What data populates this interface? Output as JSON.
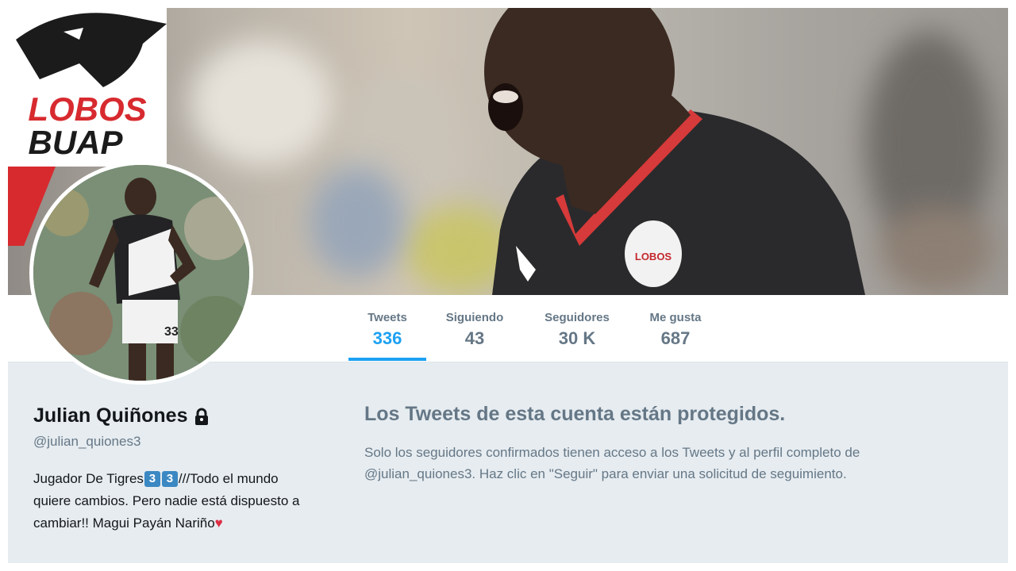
{
  "banner": {
    "logo_text_line1": "LOBOS",
    "logo_text_line2": "BUAP"
  },
  "nav": {
    "stats": [
      {
        "label": "Tweets",
        "value": "336"
      },
      {
        "label": "Siguiendo",
        "value": "43"
      },
      {
        "label": "Seguidores",
        "value": "30 K"
      },
      {
        "label": "Me gusta",
        "value": "687"
      }
    ],
    "active_index": 0,
    "accent_color": "#1da1f2"
  },
  "profile": {
    "name": "Julian Quiñones",
    "handle": "@julian_quiones3",
    "bio_part1": "Jugador De Tigres",
    "bio_emoji1": "3",
    "bio_emoji2": "3",
    "bio_part2": "///Todo el mundo quiere cambios. Pero nadie está dispuesto a cambiar!! Magui Payán Nariño",
    "bio_heart": "♥",
    "jersey_number": "33",
    "lock_icon": "lock-icon"
  },
  "protected": {
    "title": "Los Tweets de esta cuenta están protegidos.",
    "text": "Solo los seguidores confirmados tienen acceso a los Tweets y al perfil completo de @julian_quiones3. Haz clic en \"Seguir\" para enviar una solicitud de seguimiento."
  }
}
